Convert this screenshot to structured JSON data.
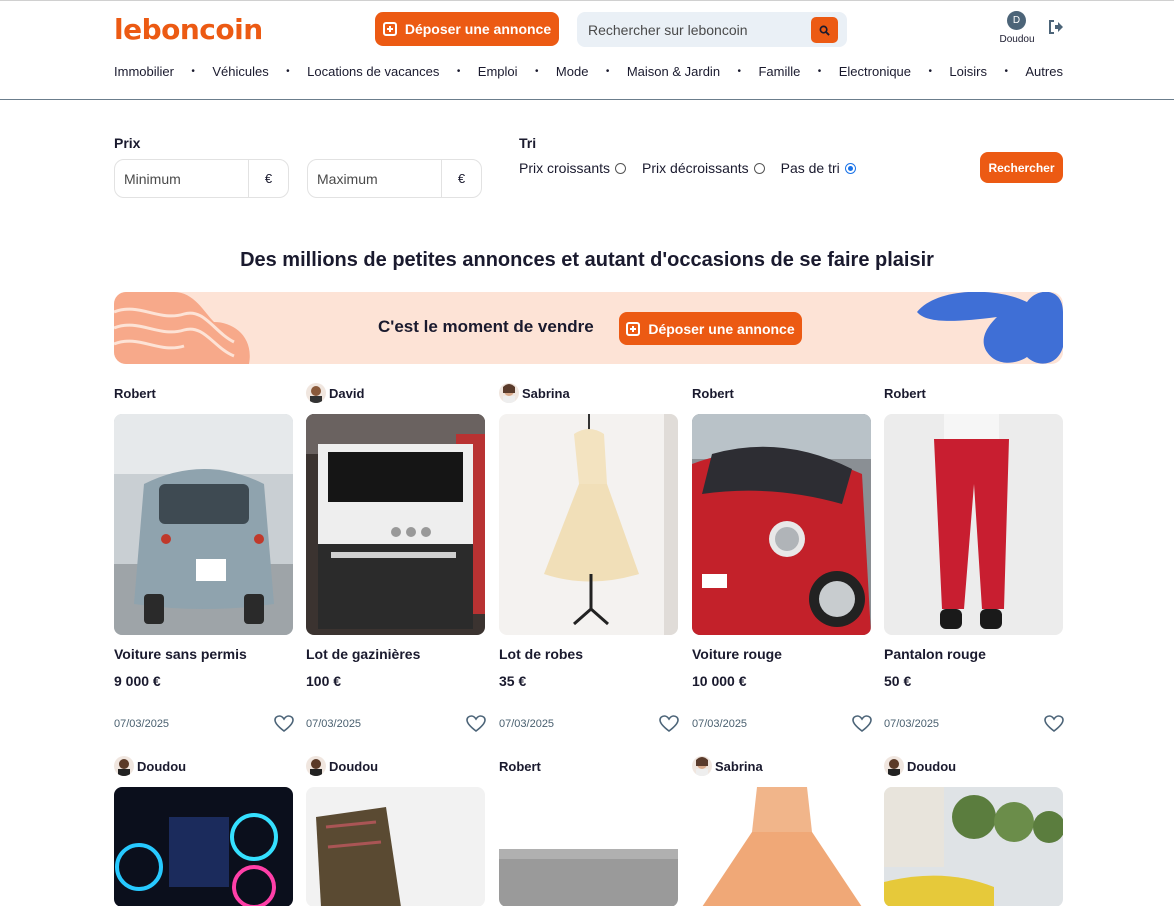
{
  "header": {
    "logo": "leboncoin",
    "post_button": "Déposer une annonce",
    "search_placeholder": "Rechercher sur leboncoin",
    "user_initial": "D",
    "user_name": "Doudou"
  },
  "nav": [
    "Immobilier",
    "Véhicules",
    "Locations de vacances",
    "Emploi",
    "Mode",
    "Maison & Jardin",
    "Famille",
    "Electronique",
    "Loisirs",
    "Autres"
  ],
  "filters": {
    "price_label": "Prix",
    "min_placeholder": "Minimum",
    "max_placeholder": "Maximum",
    "currency": "€",
    "sort_label": "Tri",
    "sort_options": [
      "Prix croissants",
      "Prix décroissants",
      "Pas de tri"
    ],
    "sort_selected": "Pas de tri",
    "search_button": "Rechercher"
  },
  "headline": "Des millions de petites annonces et autant d'occasions de se faire plaisir",
  "banner": {
    "text": "C'est le moment de vendre",
    "button": "Déposer une annonce"
  },
  "listings": [
    {
      "author": "Robert",
      "title": "Voiture sans permis",
      "price": "9 000 €",
      "date": "07/03/2025"
    },
    {
      "author": "David",
      "title": "Lot de gazinières",
      "price": "100 €",
      "date": "07/03/2025"
    },
    {
      "author": "Sabrina",
      "title": "Lot de robes",
      "price": "35 €",
      "date": "07/03/2025"
    },
    {
      "author": "Robert",
      "title": "Voiture rouge",
      "price": "10 000 €",
      "date": "07/03/2025"
    },
    {
      "author": "Robert",
      "title": "Pantalon rouge",
      "price": "50 €",
      "date": "07/03/2025"
    },
    {
      "author": "Doudou"
    },
    {
      "author": "Doudou"
    },
    {
      "author": "Robert"
    },
    {
      "author": "Sabrina"
    },
    {
      "author": "Doudou"
    }
  ],
  "colors": {
    "brand": "#ec5a13",
    "banner_bg": "#fde3d6",
    "search_bg": "#eaf0f6"
  }
}
